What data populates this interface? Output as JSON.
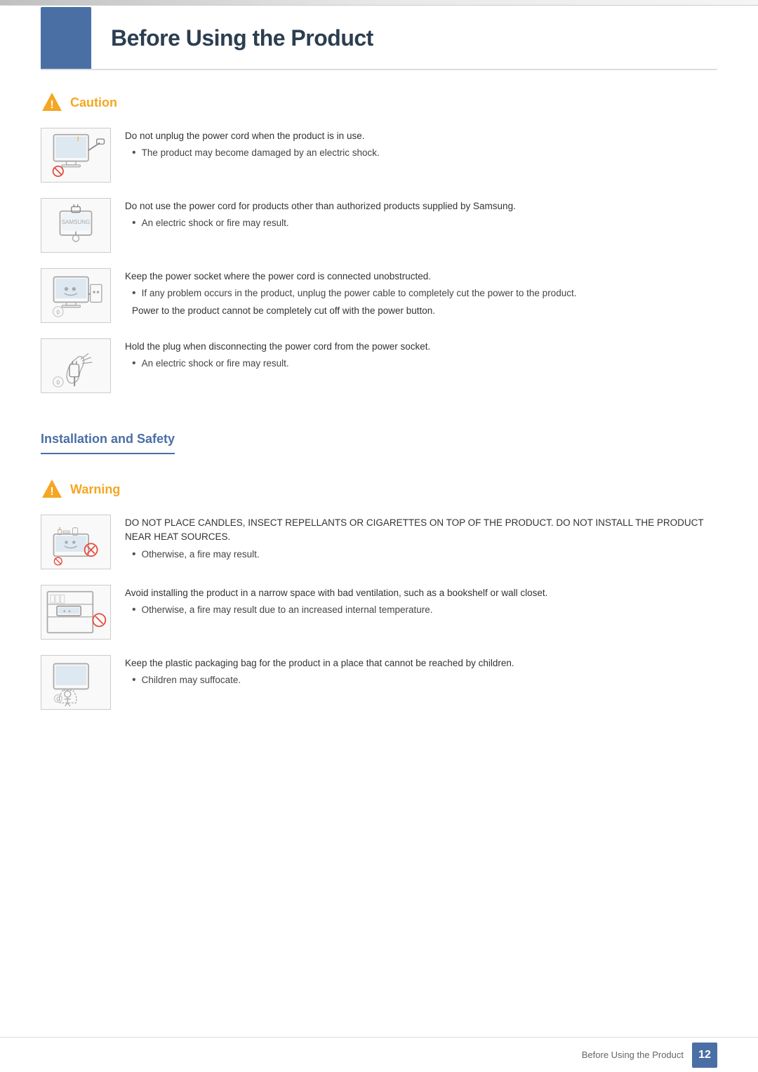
{
  "page": {
    "title": "Before Using the Product",
    "page_number": "12",
    "footer_text": "Before Using the Product"
  },
  "caution_section": {
    "label": "Caution",
    "items": [
      {
        "id": "caution-1",
        "main_text": "Do not unplug the power cord when the product is in use.",
        "sub_items": [
          "The product may become damaged by an electric shock."
        ],
        "note": null
      },
      {
        "id": "caution-2",
        "main_text": "Do not use the power cord for products other than authorized products supplied by Samsung.",
        "sub_items": [
          "An electric shock or fire may result."
        ],
        "note": null
      },
      {
        "id": "caution-3",
        "main_text": "Keep the power socket where the power cord is connected unobstructed.",
        "sub_items": [
          "If any problem occurs in the product, unplug the power cable to completely cut the power to the product."
        ],
        "note": "Power to the product cannot be completely cut off with the power button."
      },
      {
        "id": "caution-4",
        "main_text": "Hold the plug when disconnecting the power cord from the power socket.",
        "sub_items": [
          "An electric shock or fire may result."
        ],
        "note": null
      }
    ]
  },
  "install_heading": "Installation and Safety",
  "warning_section": {
    "label": "Warning",
    "items": [
      {
        "id": "warning-1",
        "main_text": "DO NOT PLACE CANDLES, INSECT REPELLANTS OR CIGARETTES ON TOP OF THE PRODUCT. DO NOT INSTALL THE PRODUCT NEAR HEAT SOURCES.",
        "sub_items": [
          "Otherwise, a fire may result."
        ],
        "note": null
      },
      {
        "id": "warning-2",
        "main_text": "Avoid installing the product in a narrow space with bad ventilation, such as a bookshelf or wall closet.",
        "sub_items": [
          "Otherwise, a fire may result due to an increased internal temperature."
        ],
        "note": null
      },
      {
        "id": "warning-3",
        "main_text": "Keep the plastic packaging bag for the product in a place that cannot be reached by children.",
        "sub_items": [
          "Children may suffocate."
        ],
        "note": null
      }
    ]
  }
}
